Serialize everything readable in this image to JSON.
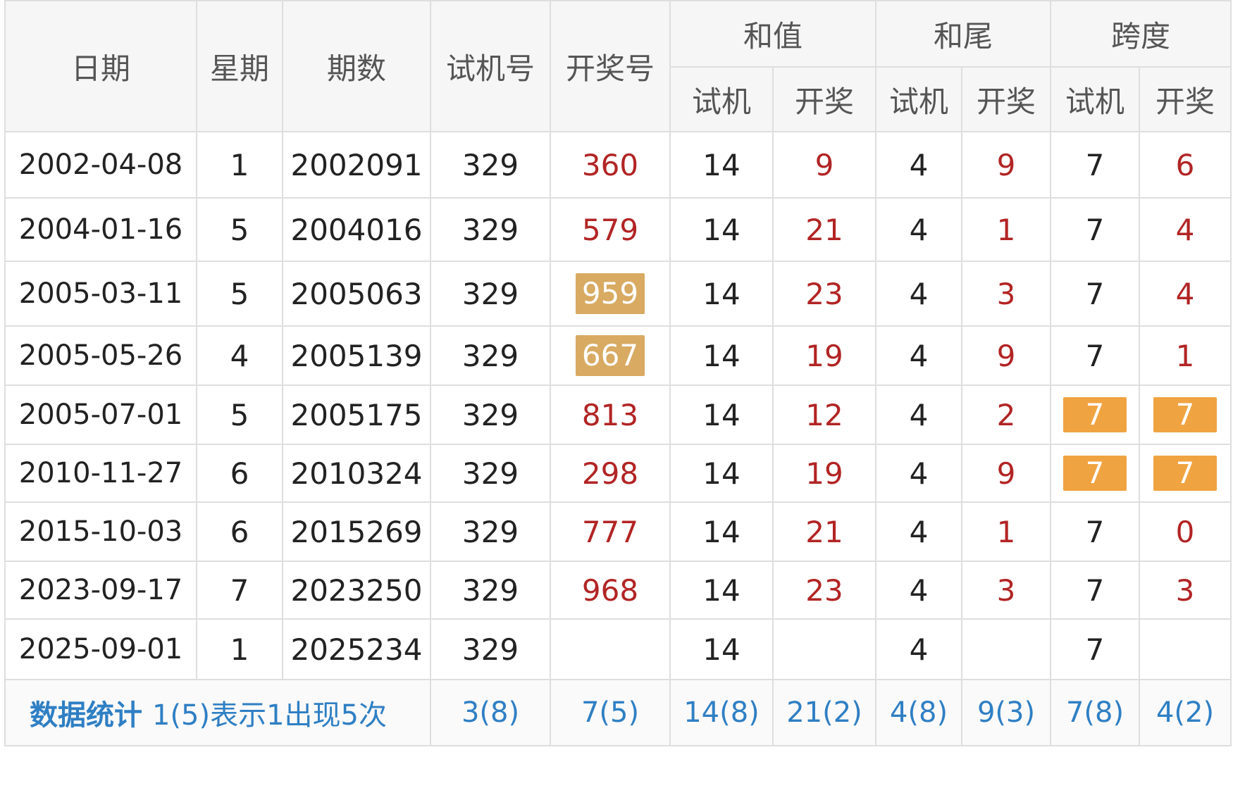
{
  "header": {
    "date": "日期",
    "weekday": "星期",
    "issue": "期数",
    "test_number": "试机号",
    "draw_number": "开奖号",
    "sum_group": "和值",
    "tail_group": "和尾",
    "span_group": "跨度",
    "sub_test": "试机",
    "sub_draw": "开奖"
  },
  "rows": [
    {
      "date": "2002-04-08",
      "weekday": "1",
      "issue": "2002091",
      "test": "329",
      "draw": "360",
      "sum_test": "14",
      "sum_draw": "9",
      "tail_test": "4",
      "tail_draw": "9",
      "span_test": "7",
      "span_draw": "6"
    },
    {
      "date": "2004-01-16",
      "weekday": "5",
      "issue": "2004016",
      "test": "329",
      "draw": "579",
      "sum_test": "14",
      "sum_draw": "21",
      "tail_test": "4",
      "tail_draw": "1",
      "span_test": "7",
      "span_draw": "4"
    },
    {
      "date": "2005-03-11",
      "weekday": "5",
      "issue": "2005063",
      "test": "329",
      "draw": "959",
      "sum_test": "14",
      "sum_draw": "23",
      "tail_test": "4",
      "tail_draw": "3",
      "span_test": "7",
      "span_draw": "4"
    },
    {
      "date": "2005-05-26",
      "weekday": "4",
      "issue": "2005139",
      "test": "329",
      "draw": "667",
      "sum_test": "14",
      "sum_draw": "19",
      "tail_test": "4",
      "tail_draw": "9",
      "span_test": "7",
      "span_draw": "1"
    },
    {
      "date": "2005-07-01",
      "weekday": "5",
      "issue": "2005175",
      "test": "329",
      "draw": "813",
      "sum_test": "14",
      "sum_draw": "12",
      "tail_test": "4",
      "tail_draw": "2",
      "span_test": "7",
      "span_draw": "7"
    },
    {
      "date": "2010-11-27",
      "weekday": "6",
      "issue": "2010324",
      "test": "329",
      "draw": "298",
      "sum_test": "14",
      "sum_draw": "19",
      "tail_test": "4",
      "tail_draw": "9",
      "span_test": "7",
      "span_draw": "7"
    },
    {
      "date": "2015-10-03",
      "weekday": "6",
      "issue": "2015269",
      "test": "329",
      "draw": "777",
      "sum_test": "14",
      "sum_draw": "21",
      "tail_test": "4",
      "tail_draw": "1",
      "span_test": "7",
      "span_draw": "0"
    },
    {
      "date": "2023-09-17",
      "weekday": "7",
      "issue": "2023250",
      "test": "329",
      "draw": "968",
      "sum_test": "14",
      "sum_draw": "23",
      "tail_test": "4",
      "tail_draw": "3",
      "span_test": "7",
      "span_draw": "3"
    },
    {
      "date": "2025-09-01",
      "weekday": "1",
      "issue": "2025234",
      "test": "329",
      "draw": "",
      "sum_test": "14",
      "sum_draw": "",
      "tail_test": "4",
      "tail_draw": "",
      "span_test": "7",
      "span_draw": ""
    }
  ],
  "highlights": {
    "draw_tan": [
      "959",
      "667"
    ],
    "span_orange_rows": [
      4,
      5
    ]
  },
  "stats": {
    "title": "数据统计",
    "note": "1(5)表示1出现5次",
    "test": "3(8)",
    "draw": "7(5)",
    "sum_test": "14(8)",
    "sum_draw": "21(2)",
    "tail_test": "4(8)",
    "tail_draw": "9(3)",
    "span_test": "7(8)",
    "span_draw": "4(2)"
  },
  "colors": {
    "draw_red": "#b22424",
    "highlight_tan": "#d8aa62",
    "highlight_orange": "#f0a341",
    "stats_blue": "#2f7fc4"
  }
}
